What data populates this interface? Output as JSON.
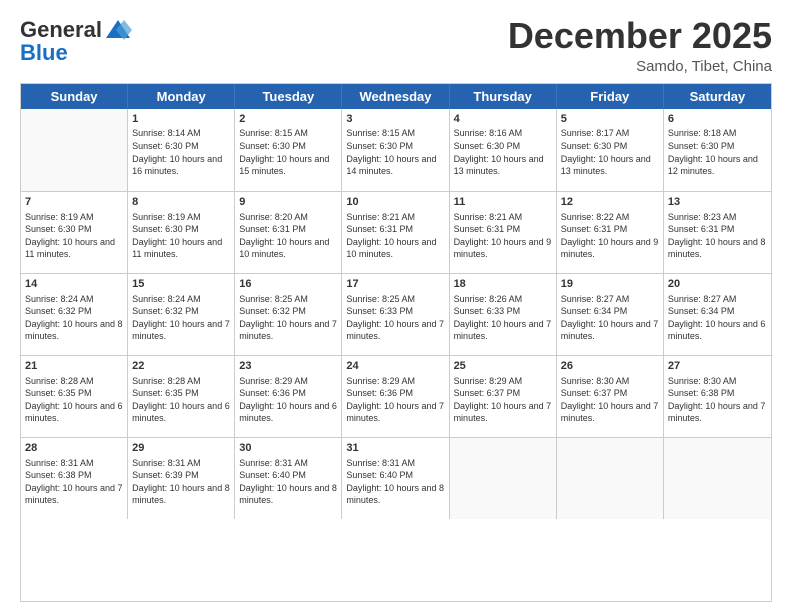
{
  "logo": {
    "general": "General",
    "blue": "Blue"
  },
  "title": "December 2025",
  "location": "Samdo, Tibet, China",
  "header_days": [
    "Sunday",
    "Monday",
    "Tuesday",
    "Wednesday",
    "Thursday",
    "Friday",
    "Saturday"
  ],
  "weeks": [
    [
      {
        "day": "",
        "sunrise": "",
        "sunset": "",
        "daylight": ""
      },
      {
        "day": "1",
        "sunrise": "Sunrise: 8:14 AM",
        "sunset": "Sunset: 6:30 PM",
        "daylight": "Daylight: 10 hours and 16 minutes."
      },
      {
        "day": "2",
        "sunrise": "Sunrise: 8:15 AM",
        "sunset": "Sunset: 6:30 PM",
        "daylight": "Daylight: 10 hours and 15 minutes."
      },
      {
        "day": "3",
        "sunrise": "Sunrise: 8:15 AM",
        "sunset": "Sunset: 6:30 PM",
        "daylight": "Daylight: 10 hours and 14 minutes."
      },
      {
        "day": "4",
        "sunrise": "Sunrise: 8:16 AM",
        "sunset": "Sunset: 6:30 PM",
        "daylight": "Daylight: 10 hours and 13 minutes."
      },
      {
        "day": "5",
        "sunrise": "Sunrise: 8:17 AM",
        "sunset": "Sunset: 6:30 PM",
        "daylight": "Daylight: 10 hours and 13 minutes."
      },
      {
        "day": "6",
        "sunrise": "Sunrise: 8:18 AM",
        "sunset": "Sunset: 6:30 PM",
        "daylight": "Daylight: 10 hours and 12 minutes."
      }
    ],
    [
      {
        "day": "7",
        "sunrise": "Sunrise: 8:19 AM",
        "sunset": "Sunset: 6:30 PM",
        "daylight": "Daylight: 10 hours and 11 minutes."
      },
      {
        "day": "8",
        "sunrise": "Sunrise: 8:19 AM",
        "sunset": "Sunset: 6:30 PM",
        "daylight": "Daylight: 10 hours and 11 minutes."
      },
      {
        "day": "9",
        "sunrise": "Sunrise: 8:20 AM",
        "sunset": "Sunset: 6:31 PM",
        "daylight": "Daylight: 10 hours and 10 minutes."
      },
      {
        "day": "10",
        "sunrise": "Sunrise: 8:21 AM",
        "sunset": "Sunset: 6:31 PM",
        "daylight": "Daylight: 10 hours and 10 minutes."
      },
      {
        "day": "11",
        "sunrise": "Sunrise: 8:21 AM",
        "sunset": "Sunset: 6:31 PM",
        "daylight": "Daylight: 10 hours and 9 minutes."
      },
      {
        "day": "12",
        "sunrise": "Sunrise: 8:22 AM",
        "sunset": "Sunset: 6:31 PM",
        "daylight": "Daylight: 10 hours and 9 minutes."
      },
      {
        "day": "13",
        "sunrise": "Sunrise: 8:23 AM",
        "sunset": "Sunset: 6:31 PM",
        "daylight": "Daylight: 10 hours and 8 minutes."
      }
    ],
    [
      {
        "day": "14",
        "sunrise": "Sunrise: 8:24 AM",
        "sunset": "Sunset: 6:32 PM",
        "daylight": "Daylight: 10 hours and 8 minutes."
      },
      {
        "day": "15",
        "sunrise": "Sunrise: 8:24 AM",
        "sunset": "Sunset: 6:32 PM",
        "daylight": "Daylight: 10 hours and 7 minutes."
      },
      {
        "day": "16",
        "sunrise": "Sunrise: 8:25 AM",
        "sunset": "Sunset: 6:32 PM",
        "daylight": "Daylight: 10 hours and 7 minutes."
      },
      {
        "day": "17",
        "sunrise": "Sunrise: 8:25 AM",
        "sunset": "Sunset: 6:33 PM",
        "daylight": "Daylight: 10 hours and 7 minutes."
      },
      {
        "day": "18",
        "sunrise": "Sunrise: 8:26 AM",
        "sunset": "Sunset: 6:33 PM",
        "daylight": "Daylight: 10 hours and 7 minutes."
      },
      {
        "day": "19",
        "sunrise": "Sunrise: 8:27 AM",
        "sunset": "Sunset: 6:34 PM",
        "daylight": "Daylight: 10 hours and 7 minutes."
      },
      {
        "day": "20",
        "sunrise": "Sunrise: 8:27 AM",
        "sunset": "Sunset: 6:34 PM",
        "daylight": "Daylight: 10 hours and 6 minutes."
      }
    ],
    [
      {
        "day": "21",
        "sunrise": "Sunrise: 8:28 AM",
        "sunset": "Sunset: 6:35 PM",
        "daylight": "Daylight: 10 hours and 6 minutes."
      },
      {
        "day": "22",
        "sunrise": "Sunrise: 8:28 AM",
        "sunset": "Sunset: 6:35 PM",
        "daylight": "Daylight: 10 hours and 6 minutes."
      },
      {
        "day": "23",
        "sunrise": "Sunrise: 8:29 AM",
        "sunset": "Sunset: 6:36 PM",
        "daylight": "Daylight: 10 hours and 6 minutes."
      },
      {
        "day": "24",
        "sunrise": "Sunrise: 8:29 AM",
        "sunset": "Sunset: 6:36 PM",
        "daylight": "Daylight: 10 hours and 7 minutes."
      },
      {
        "day": "25",
        "sunrise": "Sunrise: 8:29 AM",
        "sunset": "Sunset: 6:37 PM",
        "daylight": "Daylight: 10 hours and 7 minutes."
      },
      {
        "day": "26",
        "sunrise": "Sunrise: 8:30 AM",
        "sunset": "Sunset: 6:37 PM",
        "daylight": "Daylight: 10 hours and 7 minutes."
      },
      {
        "day": "27",
        "sunrise": "Sunrise: 8:30 AM",
        "sunset": "Sunset: 6:38 PM",
        "daylight": "Daylight: 10 hours and 7 minutes."
      }
    ],
    [
      {
        "day": "28",
        "sunrise": "Sunrise: 8:31 AM",
        "sunset": "Sunset: 6:38 PM",
        "daylight": "Daylight: 10 hours and 7 minutes."
      },
      {
        "day": "29",
        "sunrise": "Sunrise: 8:31 AM",
        "sunset": "Sunset: 6:39 PM",
        "daylight": "Daylight: 10 hours and 8 minutes."
      },
      {
        "day": "30",
        "sunrise": "Sunrise: 8:31 AM",
        "sunset": "Sunset: 6:40 PM",
        "daylight": "Daylight: 10 hours and 8 minutes."
      },
      {
        "day": "31",
        "sunrise": "Sunrise: 8:31 AM",
        "sunset": "Sunset: 6:40 PM",
        "daylight": "Daylight: 10 hours and 8 minutes."
      },
      {
        "day": "",
        "sunrise": "",
        "sunset": "",
        "daylight": ""
      },
      {
        "day": "",
        "sunrise": "",
        "sunset": "",
        "daylight": ""
      },
      {
        "day": "",
        "sunrise": "",
        "sunset": "",
        "daylight": ""
      }
    ]
  ]
}
